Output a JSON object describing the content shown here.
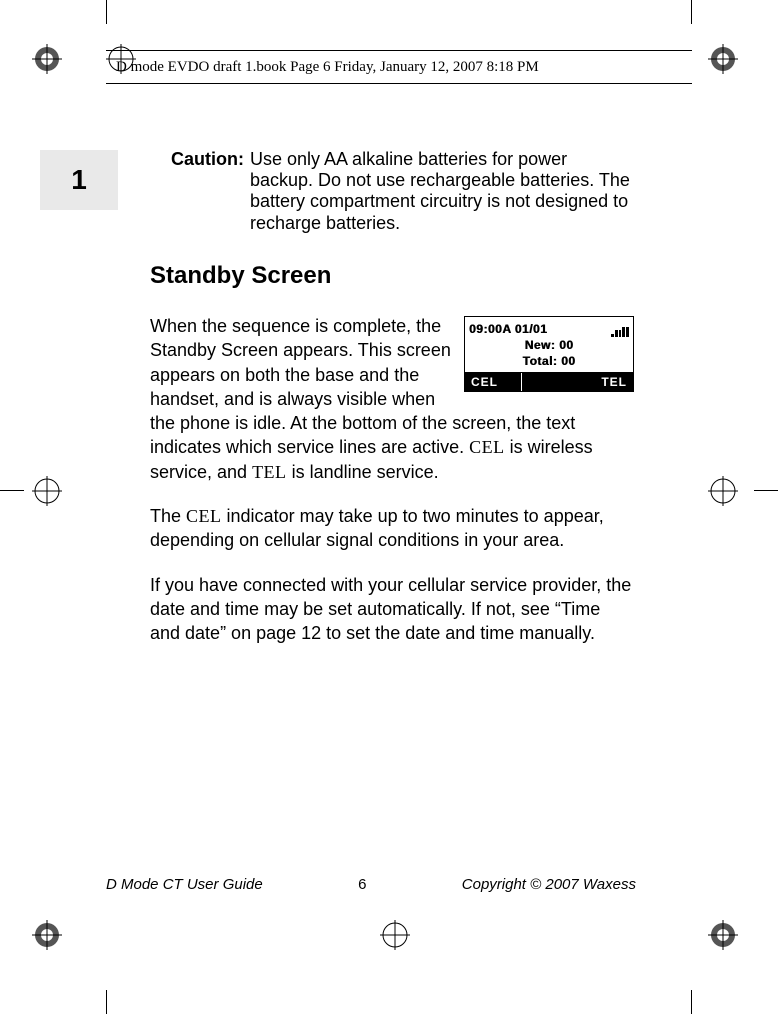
{
  "header": {
    "running": "D mode EVDO draft 1.book  Page 6  Friday, January 12, 2007  8:18 PM"
  },
  "chapter": {
    "number": "1"
  },
  "caution": {
    "label": "Caution:",
    "text": "Use only AA alkaline batteries for power backup. Do not use rechargeable batteries. The battery compartment circuitry is not designed to recharge batteries."
  },
  "section": {
    "heading": "Standby Screen"
  },
  "lcd": {
    "time_date": "09:00A 01/01",
    "line2": "New: 00",
    "line3": "Total: 00",
    "left": "CEL",
    "right": "TEL"
  },
  "body": {
    "p1a": "When the sequence is complete, the Standby Screen appears. This screen appears on both the base and the handset, and is always visible when the phone is idle. At the bottom of the screen, the text indicates which service lines are active. ",
    "cel1": "CEL",
    "p1b": " is wireless service, and ",
    "tel": "TEL",
    "p1c": " is landline service.",
    "p2a": "The ",
    "cel2": "CEL",
    "p2b": " indicator may take up to two minutes to appear, depending on cellular signal conditions in your area.",
    "p3": "If you have connected with your cellular service provider, the date and time may be set automatically. If not, see “Time and date” on page 12 to set the date and time manually."
  },
  "footer": {
    "left": "D Mode CT User Guide",
    "page": "6",
    "right": "Copyright © 2007 Waxess"
  }
}
